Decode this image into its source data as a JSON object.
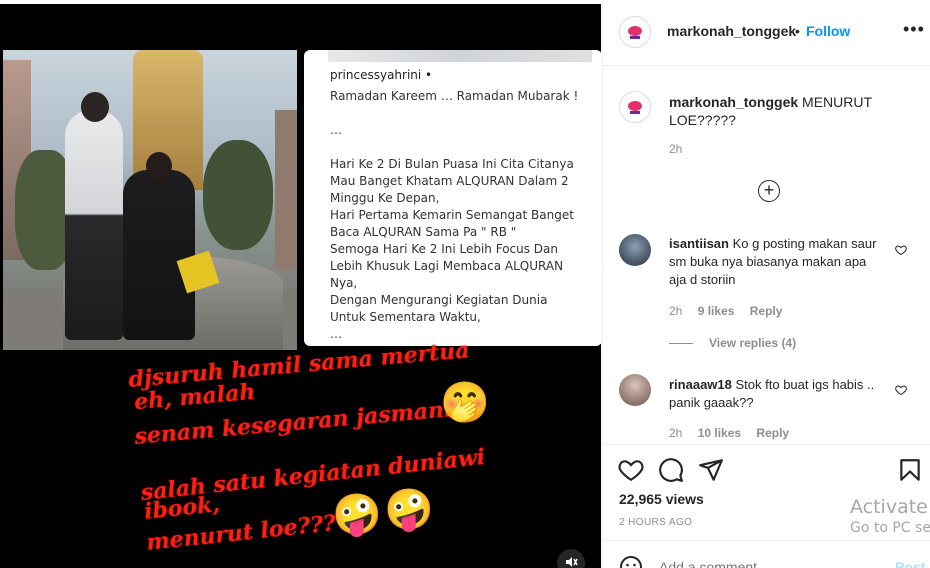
{
  "media": {
    "embedded_card": {
      "username": "princessyahrini •",
      "lines": [
        "Ramadan Kareem … Ramadan Mubarak !",
        "",
        "…",
        "",
        "Hari Ke 2 Di Bulan Puasa Ini Cita Citanya",
        "Mau Banget Khatam ALQURAN Dalam 2",
        "Minggu Ke Depan,",
        "Hari Pertama Kemarin Semangat Banget",
        "Baca ALQURAN Sama Pa \" RB \"",
        "Semoga Hari Ke 2 Ini Lebih Focus Dan",
        "Lebih Khusuk Lagi Membaca ALQURAN",
        "Nya,",
        "Dengan Mengurangi Kegiatan Dunia",
        "Untuk Sementara Waktu,",
        "…"
      ]
    },
    "overlay": {
      "line1": "djsuruh hamil sama mertua",
      "line2": "eh, malah",
      "line3": "senam kesegaran jasmani",
      "line4": "salah satu kegiatan duniawi",
      "line5": "ibook,",
      "line6": "menurut loe???",
      "color": "#ff1f10"
    },
    "emojis": [
      "🤭",
      "🤪",
      "🤪"
    ]
  },
  "post": {
    "author": "markonah_tonggek",
    "separator": "•",
    "follow_label": "Follow",
    "more_label": "•••",
    "caption": {
      "username": "markonah_tonggek",
      "text": "MENURUT LOE?????",
      "time": "2h"
    },
    "load_more_label": "+"
  },
  "comments": [
    {
      "username": "isantiisan",
      "text": "Ko g posting makan saur sm buka nya biasanya makan apa aja d storiin",
      "time": "2h",
      "likes": "9 likes",
      "reply_label": "Reply",
      "view_replies": "View replies (4)"
    },
    {
      "username": "rinaaaw18",
      "text": "Stok fto buat igs habis .. panik gaaak??",
      "time": "2h",
      "likes": "10 likes",
      "reply_label": "Reply"
    }
  ],
  "stats": {
    "views": "22,965 views",
    "posted": "2 HOURS AGO"
  },
  "composer": {
    "placeholder": "Add a comment…",
    "post_label": "Post"
  },
  "watermark": {
    "line1": "Activate W",
    "line2": "Go to PC set"
  },
  "colors": {
    "accent": "#0095f6",
    "muted": "#8e8e8e",
    "overlay_red": "#ff1f10"
  }
}
